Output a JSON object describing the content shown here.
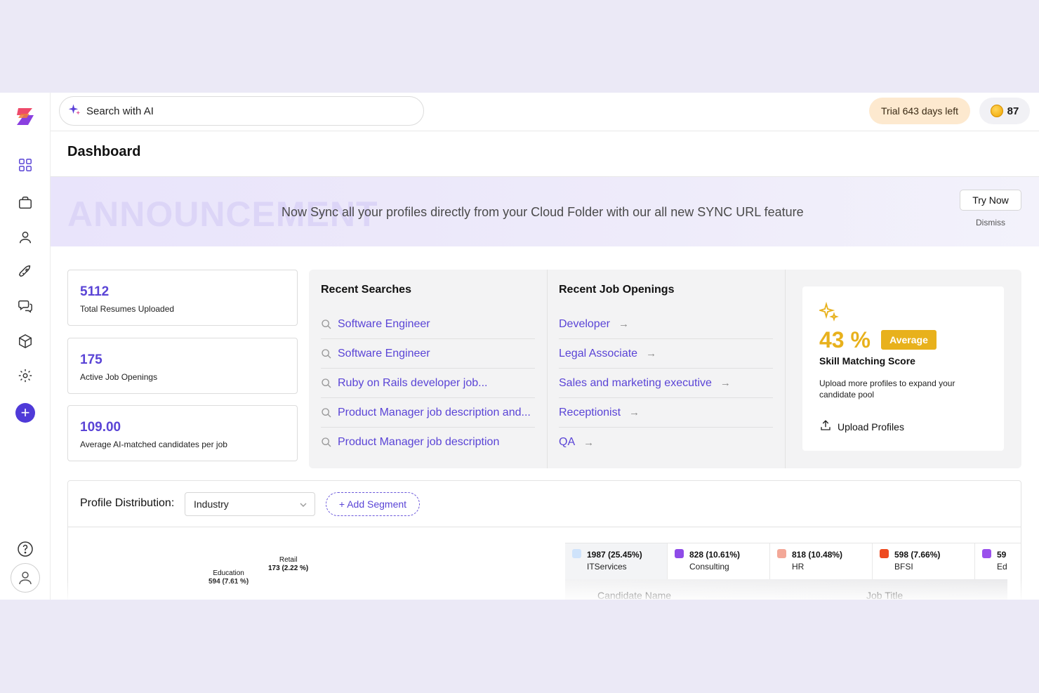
{
  "header": {
    "search_placeholder": "Search with AI",
    "trial_text": "Trial 643 days left",
    "coin_count": "87"
  },
  "page": {
    "title": "Dashboard"
  },
  "announcement": {
    "watermark": "ANNOUNCEMENT",
    "text": "Now Sync all your profiles directly from your Cloud Folder with our all new SYNC URL feature",
    "try_now_label": "Try Now",
    "dismiss_label": "Dismiss"
  },
  "stats": [
    {
      "value": "5112",
      "label": "Total Resumes Uploaded"
    },
    {
      "value": "175",
      "label": "Active Job Openings"
    },
    {
      "value": "109.00",
      "label": "Average AI-matched candidates per job"
    }
  ],
  "recent_searches": {
    "title": "Recent Searches",
    "items": [
      "Software Engineer",
      "Software Engineer",
      "Ruby on Rails developer job...",
      "Product Manager job description and...",
      "Product Manager job description"
    ]
  },
  "recent_jobs": {
    "title": "Recent Job Openings",
    "items": [
      "Developer",
      "Legal Associate",
      "Sales and marketing executive",
      "Receptionist",
      "QA"
    ]
  },
  "skill_score": {
    "value": "43 %",
    "badge": "Average",
    "label": "Skill Matching Score",
    "description": "Upload more profiles to expand your candidate pool",
    "upload_label": "Upload Profiles"
  },
  "distribution": {
    "label": "Profile Distribution:",
    "selected": "Industry",
    "add_segment_label": "+ Add Segment",
    "pie_labels": [
      {
        "name": "Education",
        "value": "594 (7.61 %)"
      },
      {
        "name": "Retail",
        "value": "173 (2.22 %)"
      }
    ],
    "legend": [
      {
        "value": "1987 (25.45%)",
        "name": "ITServices",
        "color": "#cfe3fb"
      },
      {
        "value": "828 (10.61%)",
        "name": "Consulting",
        "color": "#8e4be8"
      },
      {
        "value": "818 (10.48%)",
        "name": "HR",
        "color": "#f3a898"
      },
      {
        "value": "598 (7.66%)",
        "name": "BFSI",
        "color": "#ee4a1f"
      },
      {
        "value": "59",
        "name": "Ed",
        "color": "#9a50ec"
      }
    ],
    "table_headers": [
      "Candidate Name",
      "Job Title"
    ]
  }
}
